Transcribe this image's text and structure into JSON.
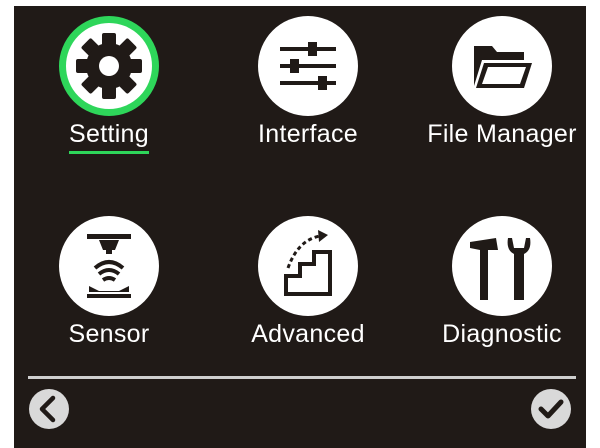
{
  "menu": {
    "items": [
      {
        "label": "Setting",
        "icon": "gear-icon",
        "selected": true
      },
      {
        "label": "Interface",
        "icon": "sliders-icon",
        "selected": false
      },
      {
        "label": "File Manager",
        "icon": "folder-icon",
        "selected": false
      },
      {
        "label": "Sensor",
        "icon": "sensor-icon",
        "selected": false
      },
      {
        "label": "Advanced",
        "icon": "stairs-icon",
        "selected": false
      },
      {
        "label": "Diagnostic",
        "icon": "tools-icon",
        "selected": false
      }
    ]
  },
  "footer": {
    "back_icon": "chevron-left-icon",
    "confirm_icon": "checkmark-icon"
  },
  "colors": {
    "background": "#201a17",
    "accent": "#2ed65a",
    "icon_bg": "#ffffff",
    "button_bg": "#d9d9d9"
  }
}
